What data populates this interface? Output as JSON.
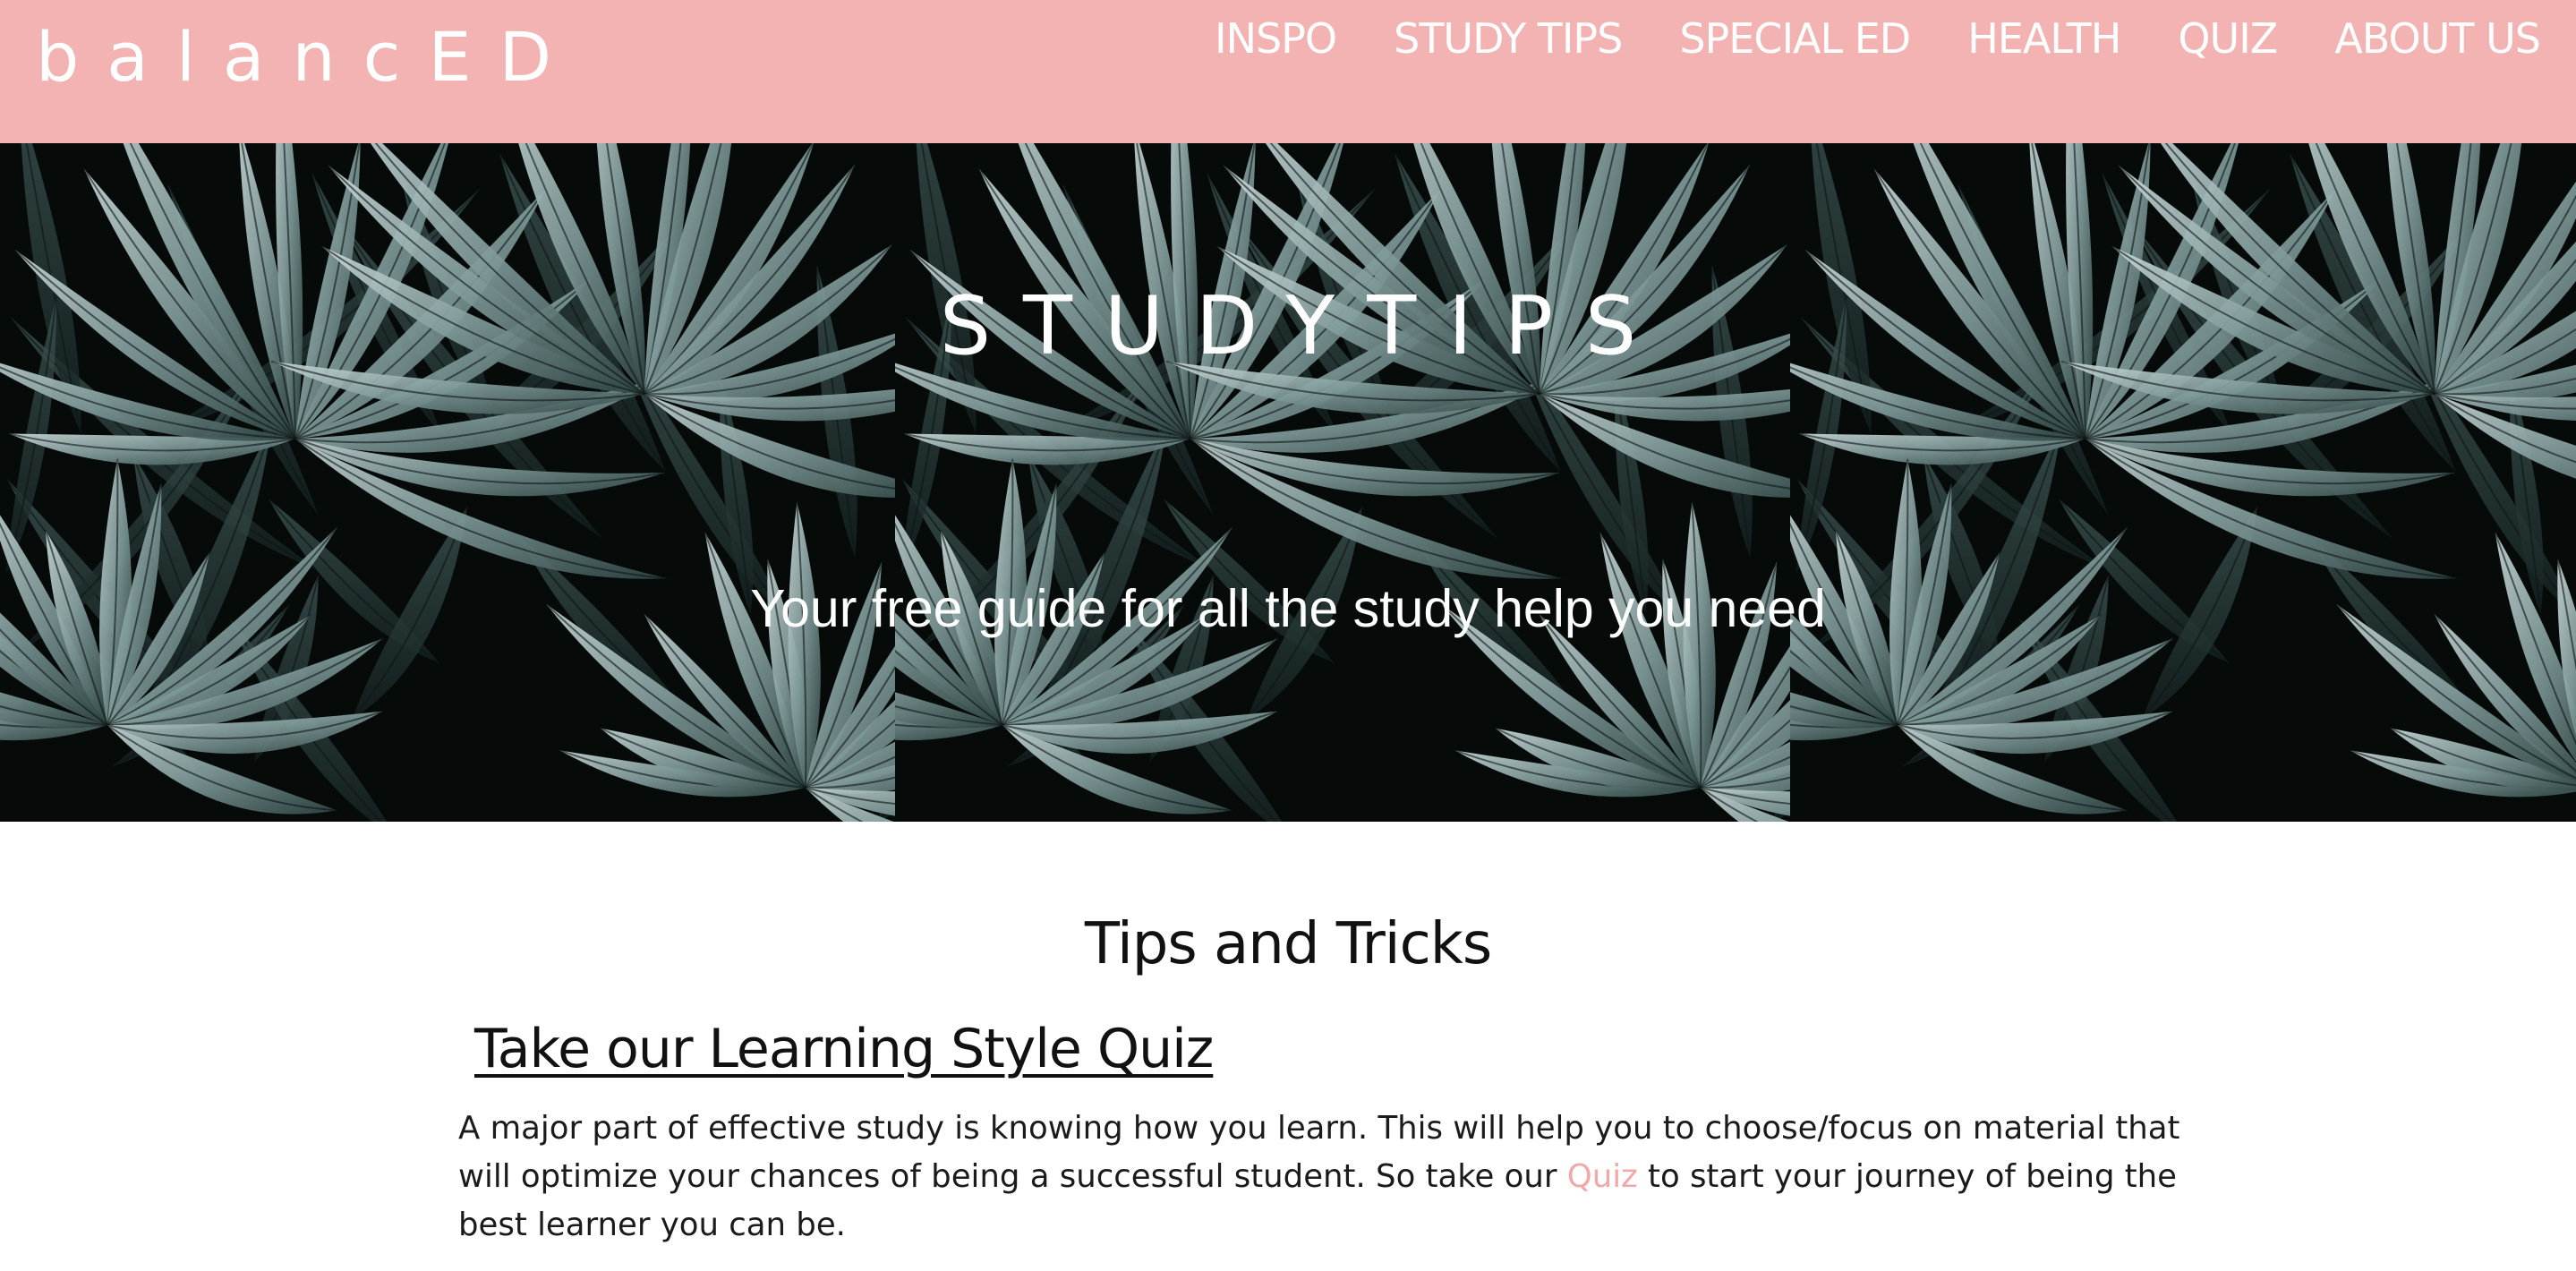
{
  "brand": "balancED",
  "nav": {
    "items": [
      {
        "label": "INSPO"
      },
      {
        "label": "STUDY TIPS"
      },
      {
        "label": "SPECIAL ED"
      },
      {
        "label": "HEALTH"
      },
      {
        "label": "QUIZ"
      },
      {
        "label": "ABOUT US"
      }
    ]
  },
  "hero": {
    "title": "STUDYTIPS",
    "subtitle": "Your free guide for all the study help you need",
    "image_icon": "palm-leaves-image"
  },
  "main": {
    "section_title": "Tips and Tricks",
    "quiz_heading": "Take our Learning Style Quiz",
    "paragraph_before_link": "A major part of effective study is knowing how you learn. This will help you to choose/focus on material that will optimize your chances of being a successful student. So take our ",
    "quiz_link": "Quiz",
    "paragraph_after_link": " to start your journey of being the best learner you can be."
  },
  "colors": {
    "header_bg": "#f4b3b3",
    "link": "#f0a8a8",
    "hero_bg": "#050807",
    "leaf": "#8fa8a8"
  }
}
